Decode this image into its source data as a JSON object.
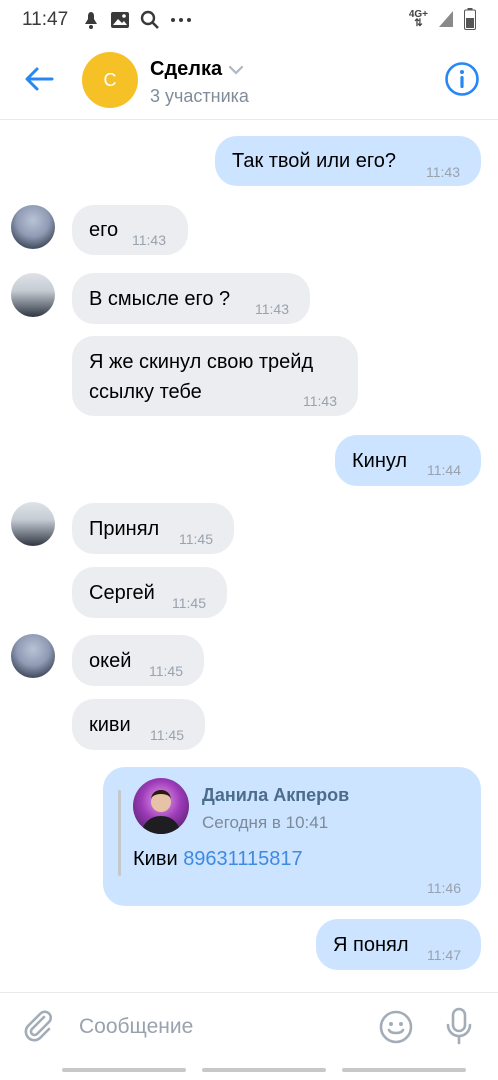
{
  "status": {
    "time": "11:47",
    "network": "4G+"
  },
  "header": {
    "avatar_letter": "С",
    "title": "Сделка",
    "subtitle": "3 участника"
  },
  "messages": [
    {
      "dir": "out",
      "text": "Так твой или его?",
      "time": "11:43"
    },
    {
      "dir": "in",
      "text": "его",
      "time": "11:43"
    },
    {
      "dir": "in",
      "text": "В смысле его ?",
      "time": "11:43"
    },
    {
      "dir": "in",
      "text": "Я же скинул свою трейд\nссылку тебе",
      "time": "11:43"
    },
    {
      "dir": "out",
      "text": "Кинул",
      "time": "11:44"
    },
    {
      "dir": "in",
      "text": "Принял",
      "time": "11:45"
    },
    {
      "dir": "in",
      "text": "Сергей",
      "time": "11:45"
    },
    {
      "dir": "in",
      "text": "окей",
      "time": "11:45"
    },
    {
      "dir": "in",
      "text": "киви",
      "time": "11:45"
    },
    {
      "dir": "out",
      "text": "Я понял",
      "time": "11:47"
    }
  ],
  "forwarded": {
    "author": "Данила Акперов",
    "date": "Сегодня в 10:41",
    "text_prefix": "Киви ",
    "phone": "89631115817",
    "time": "11:46"
  },
  "composer": {
    "placeholder": "Сообщение"
  }
}
